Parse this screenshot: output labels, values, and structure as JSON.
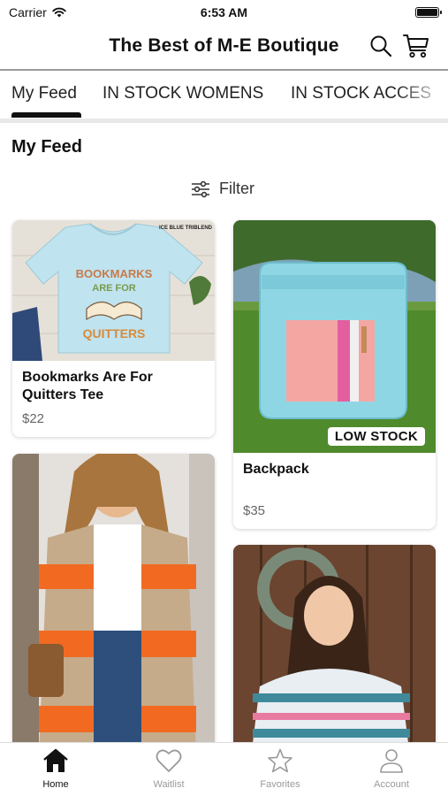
{
  "status_bar": {
    "carrier": "Carrier",
    "time": "6:53 AM"
  },
  "header": {
    "title": "The Best of M-E Boutique",
    "search_icon": "search-icon",
    "cart_icon": "cart-icon"
  },
  "tabs": [
    {
      "label": "My Feed",
      "selected": true
    },
    {
      "label": "IN STOCK WOMENS",
      "selected": false
    },
    {
      "label": "IN STOCK ACCES",
      "selected": false
    }
  ],
  "feed": {
    "title": "My Feed",
    "filter_label": "Filter",
    "products": [
      {
        "name": "Bookmarks Are For Quitters Tee",
        "price": "$22",
        "image_text": "ICE BLUE TRIBLEND",
        "shirt_lines": [
          "BOOKMARKS",
          "ARE FOR",
          "QUITTERS"
        ]
      },
      {
        "name": "Backpack",
        "price": "$35",
        "badge": "LOW STOCK"
      },
      {
        "name": "",
        "price": ""
      },
      {
        "name": "",
        "price": ""
      }
    ]
  },
  "tabbar": {
    "items": [
      {
        "label": "Home",
        "icon": "home-icon",
        "active": true
      },
      {
        "label": "Waitlist",
        "icon": "heart-icon",
        "active": false
      },
      {
        "label": "Favorites",
        "icon": "star-icon",
        "active": false
      },
      {
        "label": "Account",
        "icon": "person-icon",
        "active": false
      }
    ]
  },
  "colors": {
    "accent": "#111111",
    "inactive": "#999999"
  }
}
